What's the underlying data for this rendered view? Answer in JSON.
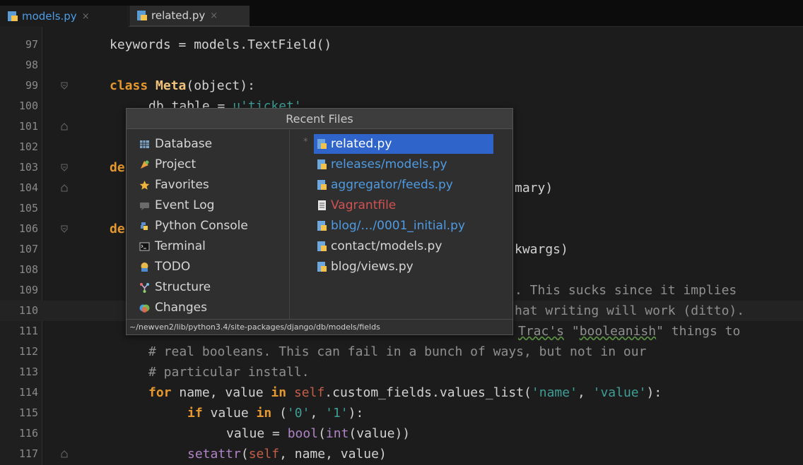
{
  "tabs": [
    {
      "label": "models.py",
      "close": "×"
    },
    {
      "label": "related.py",
      "close": "×"
    }
  ],
  "colors": {
    "accent_blue": "#4f9be3",
    "selection": "#2f65ca",
    "keyword": "#e5982f",
    "string": "#3f9e96"
  },
  "editor": {
    "lines": [
      {
        "n": "97"
      },
      {
        "n": "98"
      },
      {
        "n": "99"
      },
      {
        "n": "100"
      },
      {
        "n": "101"
      },
      {
        "n": "102"
      },
      {
        "n": "103"
      },
      {
        "n": "104"
      },
      {
        "n": "105"
      },
      {
        "n": "106"
      },
      {
        "n": "107"
      },
      {
        "n": "108"
      },
      {
        "n": "109"
      },
      {
        "n": "110"
      },
      {
        "n": "111"
      },
      {
        "n": "112"
      },
      {
        "n": "113"
      },
      {
        "n": "114"
      },
      {
        "n": "115"
      },
      {
        "n": "116"
      },
      {
        "n": "117"
      }
    ],
    "code": {
      "l97": "keywords = models.TextField()",
      "l99_kw": "class",
      "l99_name": "Meta",
      "l99_rest": "(object):",
      "l100_a": "db_table = ",
      "l100_str": "u'ticket'",
      "l103": "de",
      "l104": "mary)",
      "l106": "de",
      "l107": "kwargs)",
      "l109": ". This sucks since it implies",
      "l110": "hat writing will work (ditto).",
      "l111_a": "Trac's",
      "l111_b": " \"",
      "l111_c": "booleanish",
      "l111_d": "\" things to",
      "l112": "# real booleans. This can fail in a bunch of ways, but not in our",
      "l113": "# particular install.",
      "l114_for": "for",
      "l114_a": " name, value ",
      "l114_in": "in",
      "l114_self": "self",
      "l114_b": ".custom_fields.values_list(",
      "l114_s1": "'name'",
      "l114_c": ", ",
      "l114_s2": "'value'",
      "l114_d": "):",
      "l115_if": "if",
      "l115_a": " value ",
      "l115_in": "in",
      "l115_b": " (",
      "l115_s1": "'0'",
      "l115_c": ", ",
      "l115_s2": "'1'",
      "l115_d": "):",
      "l116_a": "value = ",
      "l116_bool": "bool",
      "l116_b": "(",
      "l116_int": "int",
      "l116_c": "(value))",
      "l117_set": "setattr",
      "l117_a": "(",
      "l117_self": "self",
      "l117_b": ", name, value)"
    }
  },
  "popup": {
    "title": "Recent Files",
    "tool_windows": [
      {
        "label": "Database",
        "icon": "database-icon"
      },
      {
        "label": "Project",
        "icon": "project-icon"
      },
      {
        "label": "Favorites",
        "icon": "star-icon"
      },
      {
        "label": "Event Log",
        "icon": "event-log-icon"
      },
      {
        "label": "Python Console",
        "icon": "python-console-icon"
      },
      {
        "label": "Terminal",
        "icon": "terminal-icon"
      },
      {
        "label": "TODO",
        "icon": "todo-icon"
      },
      {
        "label": "Structure",
        "icon": "structure-icon"
      },
      {
        "label": "Changes",
        "icon": "changes-icon"
      }
    ],
    "files": [
      {
        "label": "related.py",
        "style": "selected",
        "marker": "*"
      },
      {
        "label": "releases/models.py",
        "style": "modified"
      },
      {
        "label": "aggregator/feeds.py",
        "style": "modified"
      },
      {
        "label": "Vagrantfile",
        "style": "unversioned"
      },
      {
        "label": "blog/…/0001_initial.py",
        "style": "modified"
      },
      {
        "label": "contact/models.py",
        "style": "normal"
      },
      {
        "label": "blog/views.py",
        "style": "normal"
      }
    ],
    "status_path": "~/newven2/lib/python3.4/site-packages/django/db/models/fields"
  }
}
